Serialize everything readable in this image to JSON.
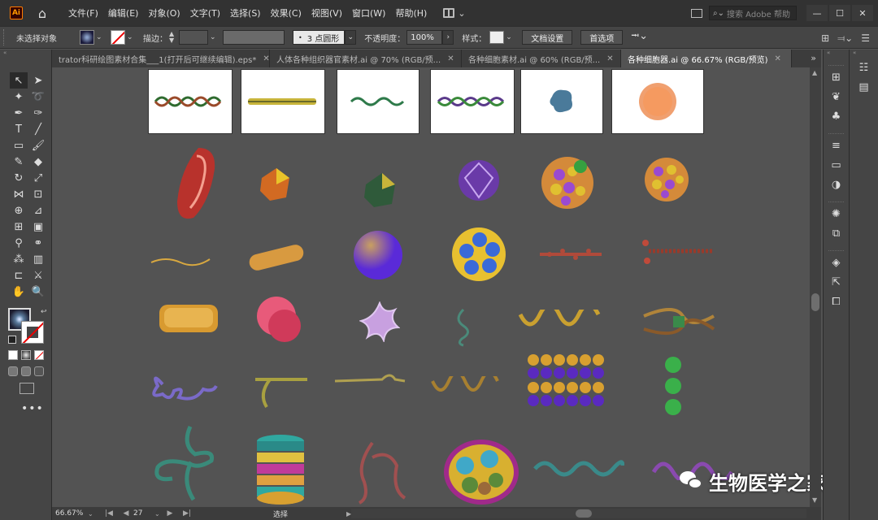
{
  "app": {
    "logo": "Ai",
    "home_icon": "home-icon"
  },
  "menu": [
    "文件(F)",
    "编辑(E)",
    "对象(O)",
    "文字(T)",
    "选择(S)",
    "效果(C)",
    "视图(V)",
    "窗口(W)",
    "帮助(H)"
  ],
  "search": {
    "placeholder": "搜索 Adobe 帮助"
  },
  "window_controls": {
    "minimize": "—",
    "maximize": "☐",
    "close": "✕"
  },
  "control_bar": {
    "selection_label": "未选择对象",
    "stroke_label": "描边：",
    "stroke_value": "",
    "brush_value": "3 点圆形",
    "opacity_label": "不透明度：",
    "opacity_value": "100%",
    "style_label": "样式：",
    "doc_setup_button": "文档设置",
    "preferences_button": "首选项"
  },
  "tabs": [
    {
      "label": "trator科研绘图素材合集___1(打开后可继续编辑).eps*",
      "active": false
    },
    {
      "label": "人体各种组织器官素材.ai @ 70% (RGB/预...",
      "active": false
    },
    {
      "label": "各种细胞素材.ai @ 60% (RGB/预...",
      "active": false
    },
    {
      "label": "各种细胞器.ai @ 66.67% (RGB/预览)",
      "active": true
    }
  ],
  "status_bar": {
    "zoom": "66.67%",
    "page": "27",
    "mode": "选择",
    "first": "|◀",
    "prev": "◀",
    "next": "▶",
    "last": "▶|"
  },
  "watermark": {
    "text": "生物医学之家"
  },
  "colors": {
    "ui_dark": "#323232",
    "ui_mid": "#454545",
    "canvas": "#535353",
    "accent_orange": "#ff7c00"
  }
}
